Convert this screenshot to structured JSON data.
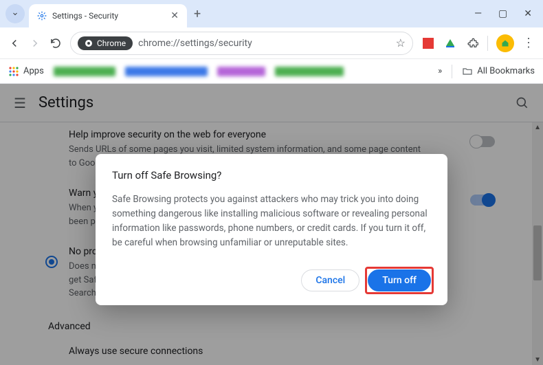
{
  "window": {
    "tab_title": "Settings - Security",
    "omnibox_label": "Chrome",
    "url": "chrome://settings/security"
  },
  "bookmarks": {
    "apps_label": "Apps",
    "all_label": "All Bookmarks"
  },
  "settings": {
    "title": "Settings",
    "options": [
      {
        "title": "Help improve security on the web for everyone",
        "desc": "Sends URLs of some pages you visit, limited system information, and some page content to Google",
        "toggle": false
      },
      {
        "title": "Warn you if passwords are exposed in a data breach",
        "desc": "When you're signed in, Chrome periodically checks your passwords against lists that have been published online. Google can't read your passwords.",
        "toggle": true
      },
      {
        "title": "No protection (not recommended)",
        "desc": "Does not protect you against dangerous websites, downloads, and extensions. You'll still get Safe Browsing settings, where available, in other Google services, like Gmail and Search."
      }
    ],
    "advanced_label": "Advanced",
    "secure_conn_label": "Always use secure connections"
  },
  "dialog": {
    "title": "Turn off Safe Browsing?",
    "body": "Safe Browsing protects you against attackers who may trick you into doing something dangerous like installing malicious software or revealing personal information like passwords, phone numbers, or credit cards. If you turn it off, be careful when browsing unfamiliar or unreputable sites.",
    "cancel": "Cancel",
    "confirm": "Turn off"
  }
}
